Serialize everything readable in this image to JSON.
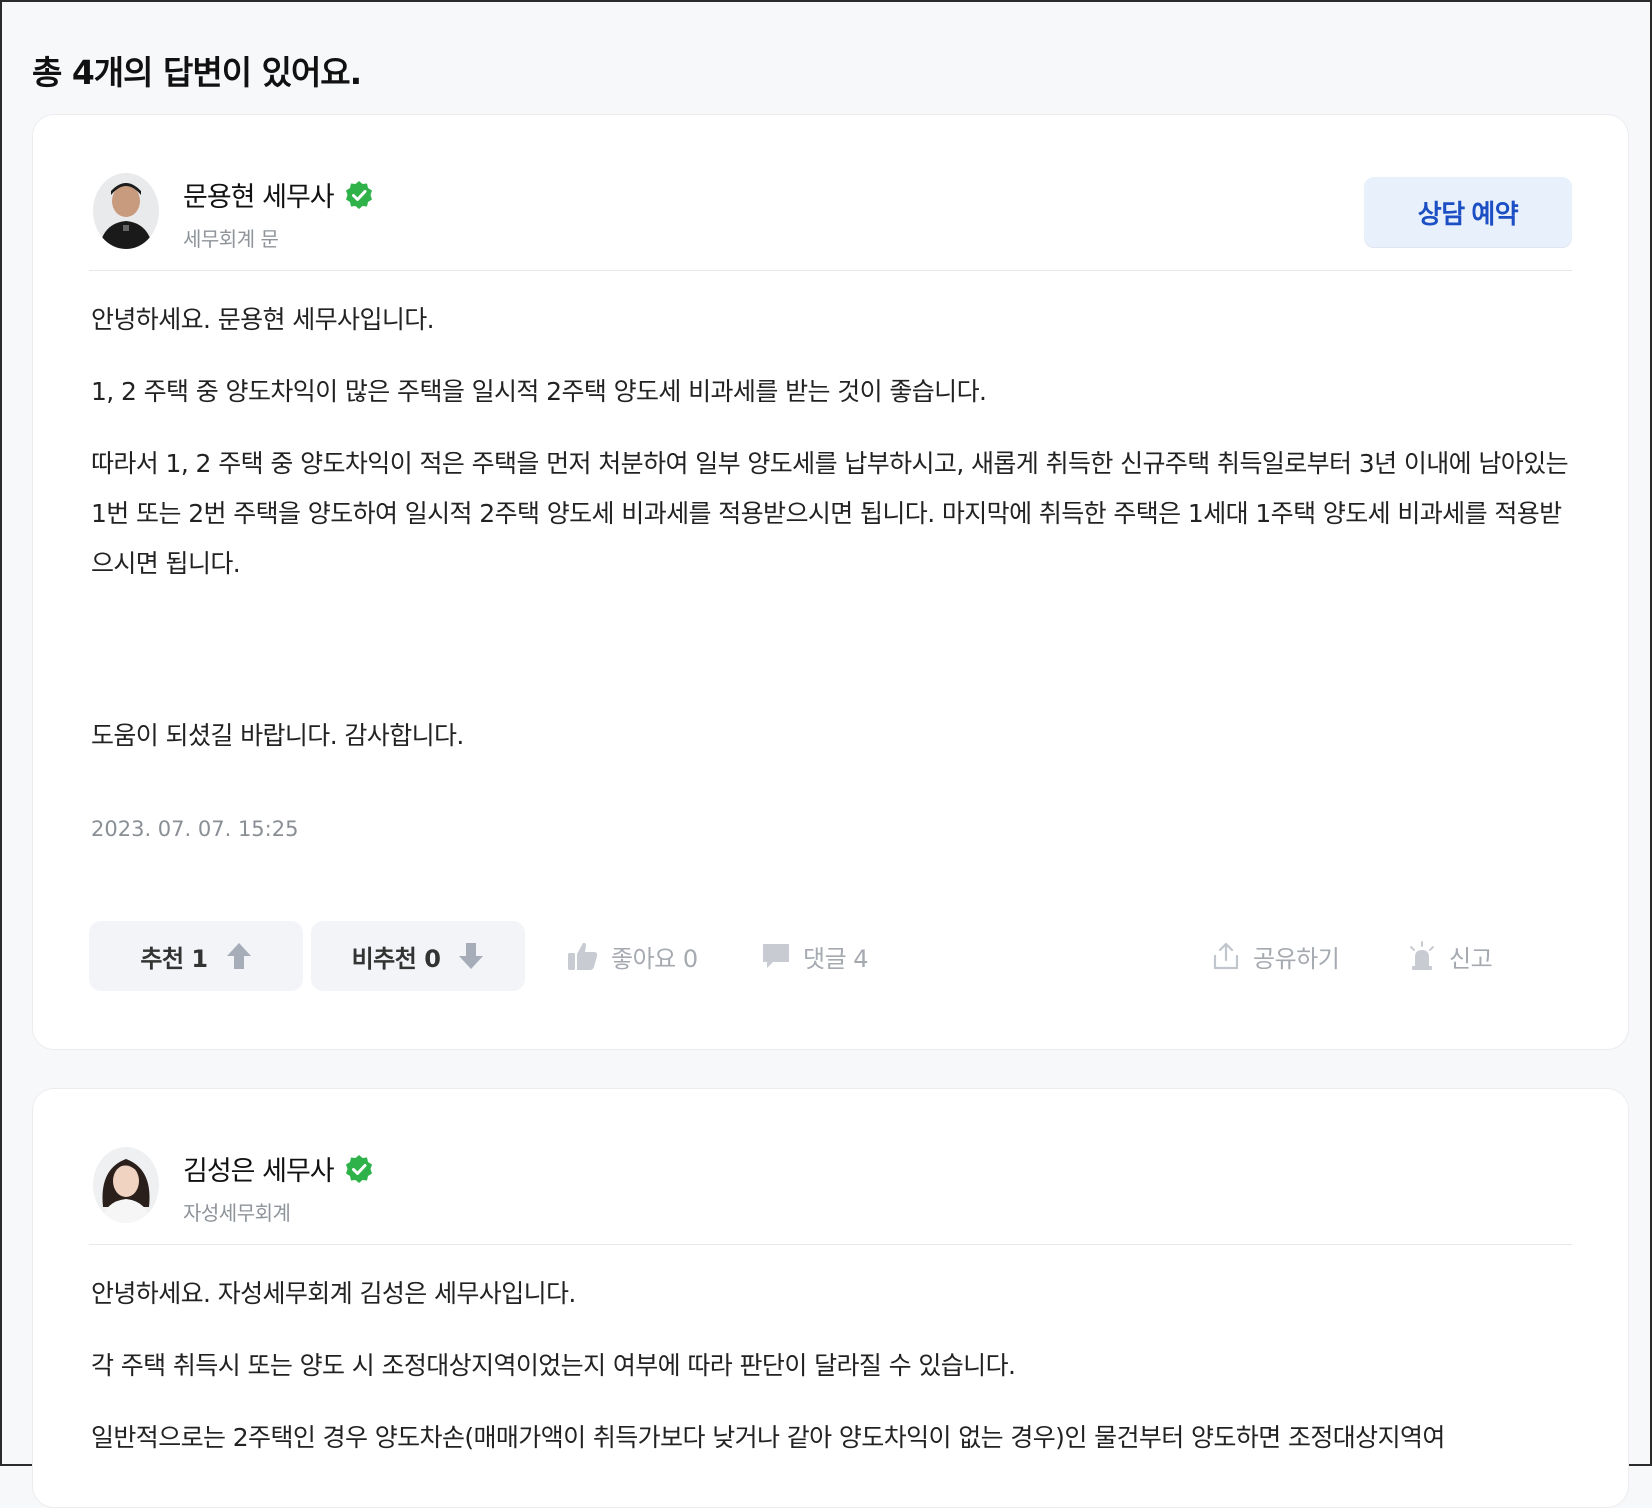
{
  "header": {
    "title": "총 4개의 답변이 있어요."
  },
  "answers": [
    {
      "name": "문용현 세무사",
      "firm": "세무회계 문",
      "consult_label": "상담 예약",
      "paragraphs": [
        "안녕하세요. 문용현 세무사입니다.",
        "1, 2 주택 중 양도차익이 많은 주택을 일시적 2주택 양도세 비과세를 받는 것이 좋습니다.",
        "따라서 1, 2 주택 중 양도차익이 적은 주택을 먼저 처분하여 일부 양도세를 납부하시고, 새롭게 취득한 신규주택 취득일로부터 3년 이내에 남아있는 1번 또는 2번 주택을 양도하여 일시적 2주택 양도세 비과세를 적용받으시면 됩니다. 마지막에 취득한 주택은 1세대 1주택 양도세 비과세를 적용받으시면 됩니다.",
        "도움이 되셨길 바랍니다. 감사합니다."
      ],
      "date": "2023. 07. 07. 15:25",
      "actions": {
        "recommend": "추천 1",
        "not_recommend": "비추천 0",
        "like": "좋아요 0",
        "comments": "댓글 4",
        "share": "공유하기",
        "report": "신고"
      }
    },
    {
      "name": "김성은 세무사",
      "firm": "자성세무회계",
      "paragraphs": [
        "안녕하세요. 자성세무회계 김성은 세무사입니다.",
        "각 주택 취득시 또는 양도 시 조정대상지역이었는지 여부에 따라 판단이 달라질 수 있습니다.",
        "일반적으로는 2주택인 경우 양도차손(매매가액이 취득가보다 낮거나 같아 양도차익이 없는 경우)인 물건부터 양도하면 조정대상지역여"
      ]
    }
  ],
  "colors": {
    "accent": "#1d4fc4",
    "verified": "#2fb24a"
  },
  "icons": [
    "verified-check-icon",
    "arrow-up-icon",
    "arrow-down-icon",
    "thumbs-up-icon",
    "comment-icon",
    "share-icon",
    "siren-icon"
  ]
}
